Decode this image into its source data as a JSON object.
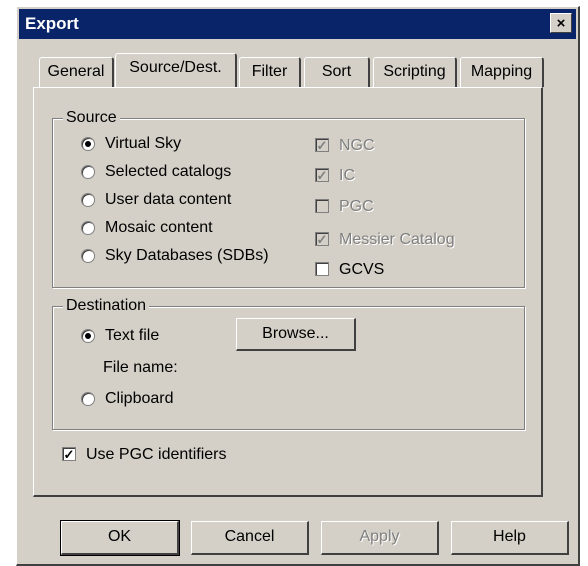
{
  "window": {
    "title": "Export",
    "close_glyph": "×"
  },
  "tabs": [
    {
      "label": "General",
      "active": false
    },
    {
      "label": "Source/Dest.",
      "active": true
    },
    {
      "label": "Filter",
      "active": false
    },
    {
      "label": "Sort",
      "active": false
    },
    {
      "label": "Scripting",
      "active": false
    },
    {
      "label": "Mapping",
      "active": false
    }
  ],
  "source": {
    "label": "Source",
    "options": [
      {
        "label": "Virtual Sky",
        "selected": true
      },
      {
        "label": "Selected catalogs",
        "selected": false
      },
      {
        "label": "User data content",
        "selected": false
      },
      {
        "label": "Mosaic content",
        "selected": false
      },
      {
        "label": "Sky Databases (SDBs)",
        "selected": false
      }
    ],
    "catalogs": [
      {
        "label": "NGC",
        "checked": true,
        "enabled": false
      },
      {
        "label": "IC",
        "checked": true,
        "enabled": false
      },
      {
        "label": "PGC",
        "checked": false,
        "enabled": false
      },
      {
        "label": "Messier Catalog",
        "checked": true,
        "enabled": false
      },
      {
        "label": "GCVS",
        "checked": false,
        "enabled": true
      }
    ]
  },
  "destination": {
    "label": "Destination",
    "text_file_label": "Text file",
    "text_file_selected": true,
    "browse_label": "Browse...",
    "file_name_label": "File name:",
    "clipboard_label": "Clipboard",
    "clipboard_selected": false
  },
  "use_pgc": {
    "label": "Use PGC identifiers",
    "checked": true
  },
  "buttons": {
    "ok": "OK",
    "cancel": "Cancel",
    "apply": "Apply",
    "help": "Help"
  },
  "glyphs": {
    "check": "✓"
  }
}
